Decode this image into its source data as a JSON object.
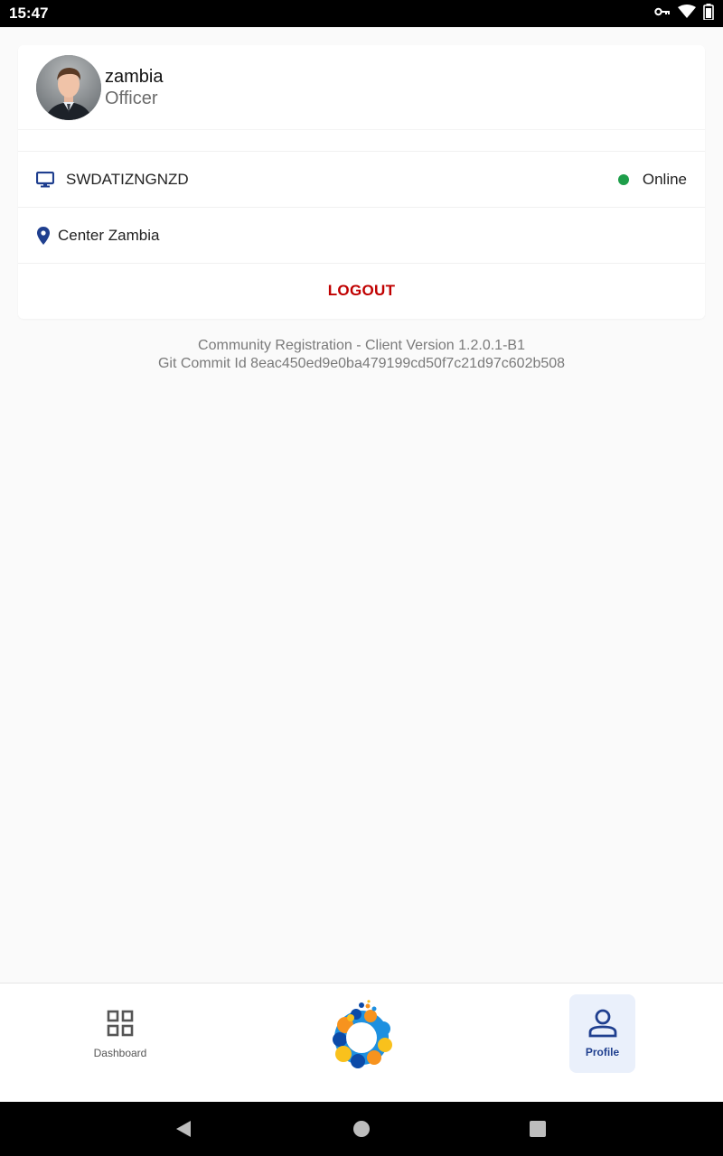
{
  "status_bar": {
    "time": "15:47",
    "icons": [
      "vpn-key-icon",
      "wifi-icon",
      "battery-icon"
    ]
  },
  "profile": {
    "name": "zambia",
    "role": "Officer",
    "device_id": "SWDATIZNGNZD",
    "connection_status": "Online",
    "location": "Center Zambia",
    "logout_label": "LOGOUT"
  },
  "version": {
    "client": "Community Registration - Client Version 1.2.0.1-B1",
    "commit": "Git Commit Id 8eac450ed9e0ba479199cd50f7c21d97c602b508"
  },
  "bottom_nav": {
    "dashboard_label": "Dashboard",
    "profile_label": "Profile"
  },
  "colors": {
    "accent": "#1f3f8f",
    "online": "#1e9e4a",
    "logout": "#c00000"
  }
}
